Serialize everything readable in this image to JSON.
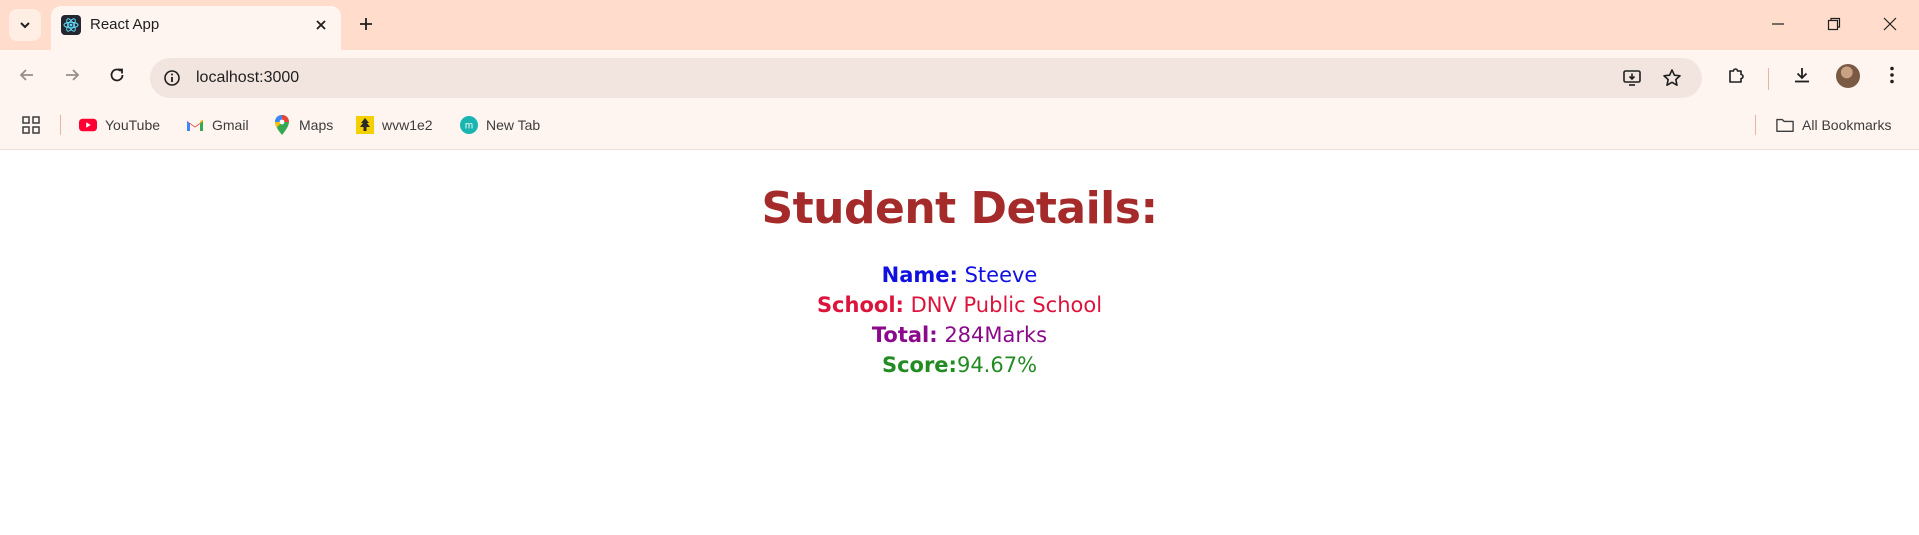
{
  "browser": {
    "tab": {
      "title": "React App",
      "favicon": "react-logo-icon"
    },
    "address": {
      "url": "localhost:3000"
    },
    "bookmarks": [
      {
        "label": "YouTube",
        "icon": "youtube-icon"
      },
      {
        "label": "Gmail",
        "icon": "gmail-icon"
      },
      {
        "label": "Maps",
        "icon": "maps-icon"
      },
      {
        "label": "wvw1e2",
        "icon": "wvw1e2-icon"
      },
      {
        "label": "New Tab",
        "icon": "new-tab-m-icon"
      }
    ],
    "all_bookmarks_label": "All Bookmarks",
    "colors": {
      "tabstrip": "#ffdccb",
      "toolbar": "#fff5f0",
      "omnibox": "#f2e5df"
    }
  },
  "page": {
    "heading": "Student Details:",
    "fields": [
      {
        "label": "Name:",
        "value": " Steeve",
        "color": "#1010e0"
      },
      {
        "label": "School:",
        "value": " DNV Public School",
        "color": "#dc143c"
      },
      {
        "label": "Total:",
        "value": " 284Marks",
        "color": "#8b0a8b"
      },
      {
        "label": "Score:",
        "value": "94.67%",
        "color": "#228b22"
      }
    ],
    "heading_color": "#a52a2a"
  }
}
